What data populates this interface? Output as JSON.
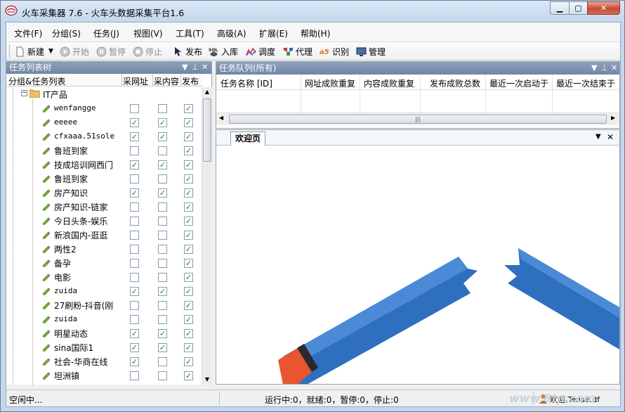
{
  "window": {
    "title": "火车采集器 7.6 - 火车头数据采集平台1.6",
    "min": "▁",
    "max": "▢",
    "close": "✕"
  },
  "menu": [
    "文件(F)",
    "分组(S)",
    "任务(J)",
    "视图(V)",
    "工具(T)",
    "高级(A)",
    "扩展(E)",
    "帮助(H)"
  ],
  "toolbar": {
    "new": "新建",
    "start": "开始",
    "pause": "暂停",
    "stop": "停止",
    "publish": "发布",
    "import": "入库",
    "debug": "调度",
    "proxy": "代理",
    "recognize": "识别",
    "manage": "管理"
  },
  "left_pane": {
    "title": "任务列表树",
    "columns": [
      "分组&任务列表",
      "采网址",
      "采内容",
      "发布"
    ],
    "group": "IT产品",
    "tasks": [
      {
        "name": "wenfangge",
        "zh": false,
        "url": false,
        "content": false,
        "publish": true
      },
      {
        "name": "eeeee",
        "zh": false,
        "url": true,
        "content": true,
        "publish": true
      },
      {
        "name": "cfxaaa.51sole.",
        "zh": false,
        "url": true,
        "content": true,
        "publish": true
      },
      {
        "name": "鲁班到家",
        "zh": true,
        "url": false,
        "content": false,
        "publish": true
      },
      {
        "name": "技成培训网西门",
        "zh": true,
        "url": true,
        "content": true,
        "publish": true
      },
      {
        "name": "鲁班到家",
        "zh": true,
        "url": false,
        "content": false,
        "publish": true
      },
      {
        "name": "房产知识",
        "zh": true,
        "url": true,
        "content": true,
        "publish": true
      },
      {
        "name": "房产知识-链家",
        "zh": true,
        "url": false,
        "content": false,
        "publish": true
      },
      {
        "name": "今日头条-娱乐",
        "zh": true,
        "url": false,
        "content": false,
        "publish": true
      },
      {
        "name": "新浪国内-逛逛",
        "zh": true,
        "url": false,
        "content": false,
        "publish": true
      },
      {
        "name": "两性2",
        "zh": true,
        "url": false,
        "content": false,
        "publish": true
      },
      {
        "name": "备孕",
        "zh": true,
        "url": false,
        "content": false,
        "publish": true
      },
      {
        "name": "电影",
        "zh": true,
        "url": false,
        "content": false,
        "publish": true
      },
      {
        "name": "zuida",
        "zh": false,
        "url": true,
        "content": true,
        "publish": true
      },
      {
        "name": "27刷粉-抖音(刚",
        "zh": true,
        "url": false,
        "content": false,
        "publish": true
      },
      {
        "name": "zuida",
        "zh": false,
        "url": false,
        "content": false,
        "publish": true
      },
      {
        "name": "明星动态",
        "zh": true,
        "url": true,
        "content": true,
        "publish": true
      },
      {
        "name": "sina国际1",
        "zh": true,
        "url": true,
        "content": true,
        "publish": true
      },
      {
        "name": "社会-华商在线",
        "zh": true,
        "url": true,
        "content": false,
        "publish": true
      },
      {
        "name": "坦洲镇",
        "zh": true,
        "url": false,
        "content": false,
        "publish": true
      }
    ]
  },
  "queue_pane": {
    "title": "任务队列(所有)",
    "columns": [
      "任务名称 [ID]",
      "网址成败重复",
      "内容成败重复",
      "发布成败总数",
      "最近一次启动于",
      "最近一次结束于"
    ]
  },
  "welcome_tab": {
    "label": "欢迎页"
  },
  "status": {
    "left": "空闲中...",
    "center": "运行中:0，就绪:0，暂停:0，停止:0",
    "right": "欢迎,Tense.df",
    "watermark": "www.8tp.com"
  },
  "colors": {
    "pane_header": "#7a8fae",
    "stick_blue": "#2e6fc0",
    "stick_tip": "#e8552e"
  }
}
